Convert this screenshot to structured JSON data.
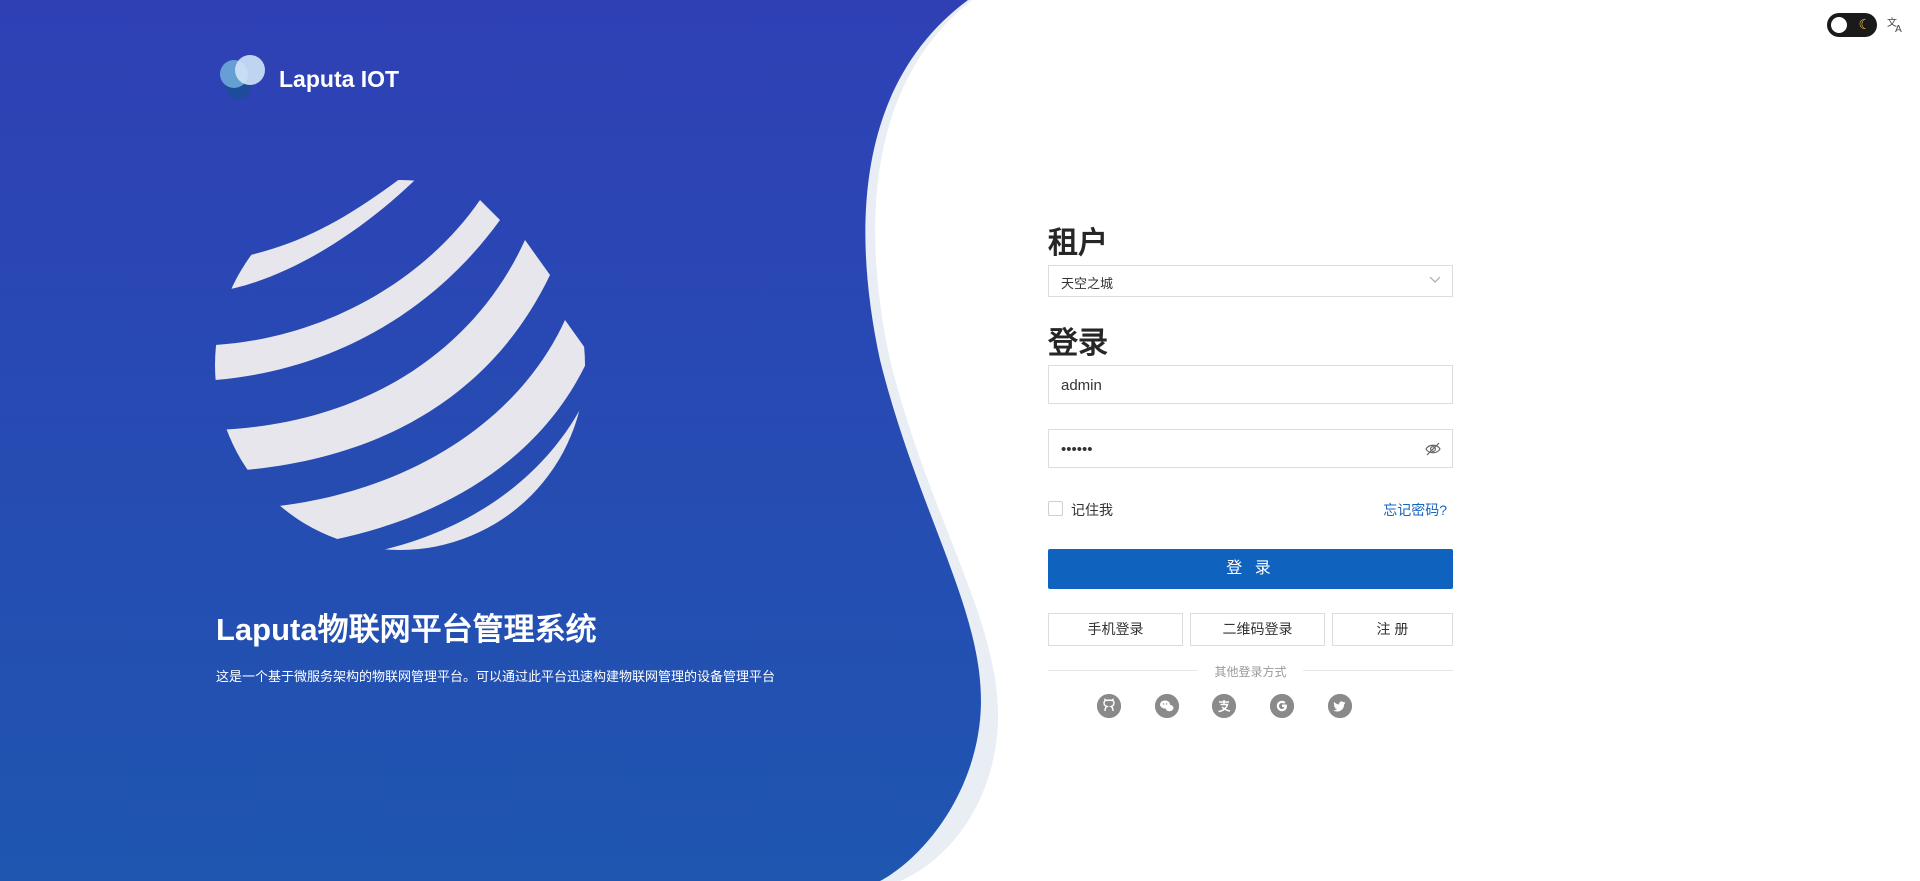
{
  "brand": {
    "title": "Laputa IOT"
  },
  "hero": {
    "title": "Laputa物联网平台管理系统",
    "description": "这是一个基于微服务架构的物联网管理平台。可以通过此平台迅速构建物联网管理的设备管理平台"
  },
  "header": {
    "theme_toggle_icon": "moon-icon",
    "language_icon": "translate-icon"
  },
  "form": {
    "tenant_title": "租户",
    "tenant_value": "天空之城",
    "login_title": "登录",
    "username_value": "admin",
    "password_value": "••••••",
    "remember_label": "记住我",
    "forgot_label": "忘记密码?",
    "login_button": "登 录",
    "phone_login": "手机登录",
    "qrcode_login": "二维码登录",
    "register": "注 册",
    "other_methods": "其他登录方式",
    "social_icons": [
      "github-icon",
      "wechat-icon",
      "alipay-icon",
      "google-icon",
      "twitter-icon"
    ]
  },
  "colors": {
    "panel_top": "#2f40b5",
    "panel_bottom": "#1e56b0",
    "accent": "#0f62bd",
    "link": "#1565c0"
  }
}
